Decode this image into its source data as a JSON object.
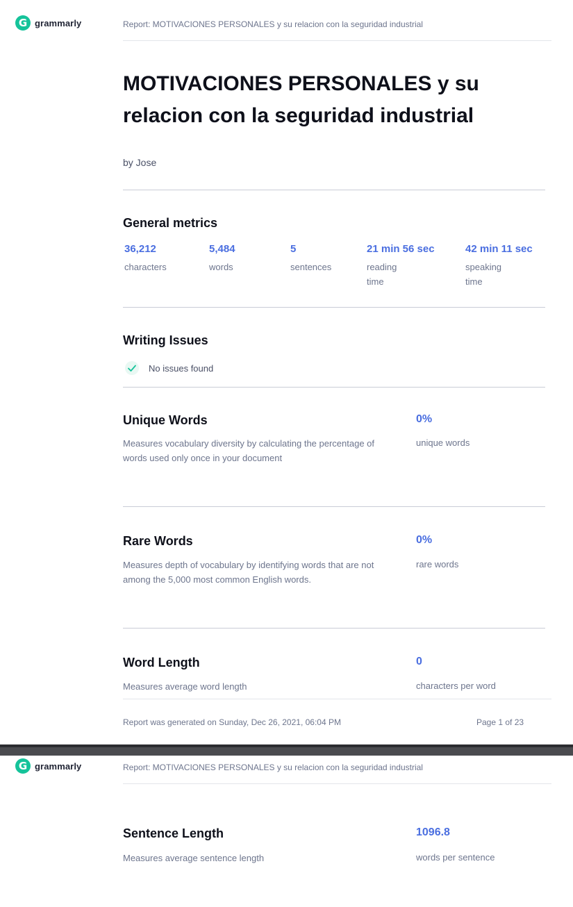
{
  "brand": {
    "name": "grammarly",
    "logo_letter": "G",
    "color": "#15c39a"
  },
  "header": {
    "report_title": "Report: MOTIVACIONES PERSONALES y su relacion con la seguridad industrial"
  },
  "document": {
    "title": "MOTIVACIONES PERSONALES y su relacion con la seguridad industrial",
    "author": "by Jose"
  },
  "general_metrics": {
    "heading": "General metrics",
    "items": [
      {
        "value": "36,212",
        "label": "characters"
      },
      {
        "value": "5,484",
        "label": "words"
      },
      {
        "value": "5",
        "label": "sentences"
      },
      {
        "value": "21 min 56 sec",
        "label": "reading time"
      },
      {
        "value": "42 min 11 sec",
        "label": "speaking time"
      }
    ]
  },
  "writing_issues": {
    "heading": "Writing Issues",
    "status": "No issues found"
  },
  "unique_words": {
    "heading": "Unique Words",
    "description": "Measures vocabulary diversity by calculating the percentage of words used only once in your document",
    "value": "0%",
    "unit": "unique words"
  },
  "rare_words": {
    "heading": "Rare Words",
    "description": "Measures depth of vocabulary by identifying words that are not among the 5,000 most common English words.",
    "value": "0%",
    "unit": "rare words"
  },
  "word_length": {
    "heading": "Word Length",
    "description": "Measures average word length",
    "value": "0",
    "unit": "characters per word"
  },
  "footer": {
    "generated": "Report was generated on Sunday, Dec 26, 2021, 06:04 PM",
    "page": "Page 1 of 23"
  },
  "sentence_length": {
    "heading": "Sentence Length",
    "description": "Measures average sentence length",
    "value": "1096.8",
    "unit": "words per sentence"
  },
  "colors": {
    "accent": "#4a6ee0",
    "check": "#15c39a",
    "muted": "#6d758d"
  }
}
